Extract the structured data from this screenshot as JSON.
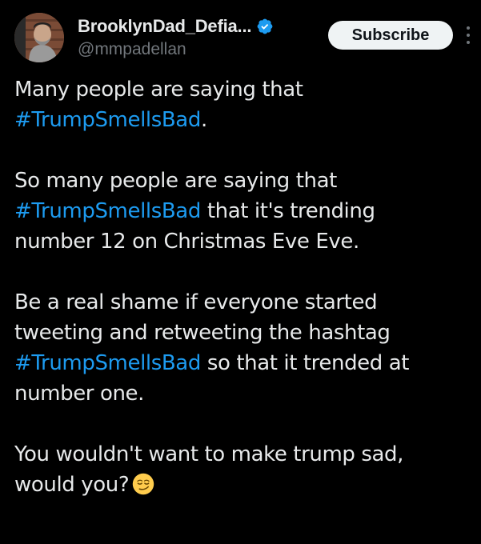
{
  "user": {
    "display_name": "BrooklynDad_Defia...",
    "handle": "@mmpadellan"
  },
  "actions": {
    "subscribe_label": "Subscribe"
  },
  "colors": {
    "background": "#000000",
    "text": "#e7e9ea",
    "hashtag": "#1d9bf0",
    "handle": "#71767b",
    "verified": "#1d9bf0"
  },
  "tweet": {
    "p1": {
      "l1": "Many people are saying that",
      "l2_hashtag": "#TrumpSmellsBad",
      "l2_after": "."
    },
    "p2": {
      "l1": "So many people are saying that",
      "l2_hashtag": "#TrumpSmellsBad",
      "l2_after": " that it's trending",
      "l3": "number 12 on Christmas Eve Eve."
    },
    "p3": {
      "l1": "Be a real shame if everyone started",
      "l2": "tweeting and retweeting the hashtag",
      "l3_hashtag": "#TrumpSmellsBad",
      "l3_after": " so that it trended at",
      "l4": "number one."
    },
    "p4": {
      "l1": "You wouldn't want to make trump sad,",
      "l2": "would you?"
    }
  },
  "icons": {
    "avatar": "avatar",
    "verified": "verified-badge-icon",
    "more": "more-options-icon",
    "emoji": "smirking-face-emoji"
  }
}
